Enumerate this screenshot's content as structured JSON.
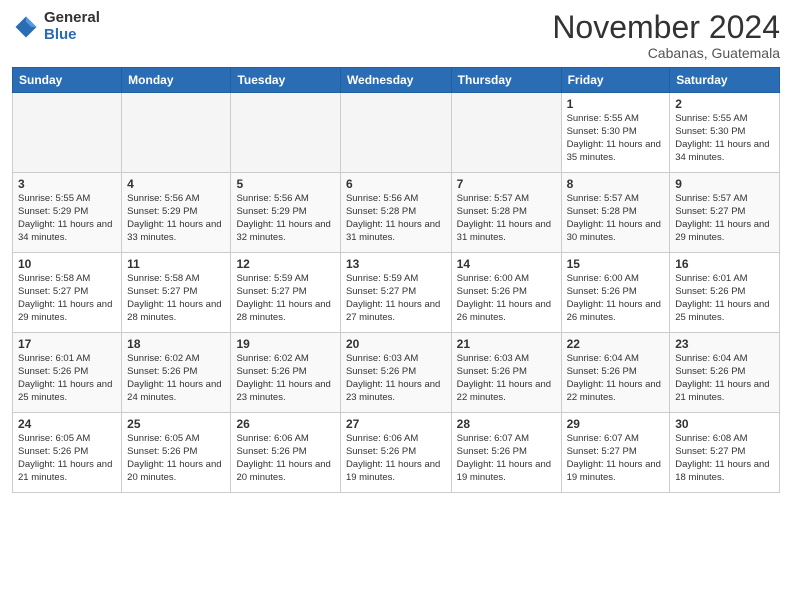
{
  "logo": {
    "general": "General",
    "blue": "Blue"
  },
  "title": "November 2024",
  "location": "Cabanas, Guatemala",
  "days_of_week": [
    "Sunday",
    "Monday",
    "Tuesday",
    "Wednesday",
    "Thursday",
    "Friday",
    "Saturday"
  ],
  "weeks": [
    [
      {
        "day": "",
        "empty": true
      },
      {
        "day": "",
        "empty": true
      },
      {
        "day": "",
        "empty": true
      },
      {
        "day": "",
        "empty": true
      },
      {
        "day": "",
        "empty": true
      },
      {
        "day": "1",
        "sunrise": "Sunrise: 5:55 AM",
        "sunset": "Sunset: 5:30 PM",
        "daylight": "Daylight: 11 hours and 35 minutes."
      },
      {
        "day": "2",
        "sunrise": "Sunrise: 5:55 AM",
        "sunset": "Sunset: 5:30 PM",
        "daylight": "Daylight: 11 hours and 34 minutes."
      }
    ],
    [
      {
        "day": "3",
        "sunrise": "Sunrise: 5:55 AM",
        "sunset": "Sunset: 5:29 PM",
        "daylight": "Daylight: 11 hours and 34 minutes."
      },
      {
        "day": "4",
        "sunrise": "Sunrise: 5:56 AM",
        "sunset": "Sunset: 5:29 PM",
        "daylight": "Daylight: 11 hours and 33 minutes."
      },
      {
        "day": "5",
        "sunrise": "Sunrise: 5:56 AM",
        "sunset": "Sunset: 5:29 PM",
        "daylight": "Daylight: 11 hours and 32 minutes."
      },
      {
        "day": "6",
        "sunrise": "Sunrise: 5:56 AM",
        "sunset": "Sunset: 5:28 PM",
        "daylight": "Daylight: 11 hours and 31 minutes."
      },
      {
        "day": "7",
        "sunrise": "Sunrise: 5:57 AM",
        "sunset": "Sunset: 5:28 PM",
        "daylight": "Daylight: 11 hours and 31 minutes."
      },
      {
        "day": "8",
        "sunrise": "Sunrise: 5:57 AM",
        "sunset": "Sunset: 5:28 PM",
        "daylight": "Daylight: 11 hours and 30 minutes."
      },
      {
        "day": "9",
        "sunrise": "Sunrise: 5:57 AM",
        "sunset": "Sunset: 5:27 PM",
        "daylight": "Daylight: 11 hours and 29 minutes."
      }
    ],
    [
      {
        "day": "10",
        "sunrise": "Sunrise: 5:58 AM",
        "sunset": "Sunset: 5:27 PM",
        "daylight": "Daylight: 11 hours and 29 minutes."
      },
      {
        "day": "11",
        "sunrise": "Sunrise: 5:58 AM",
        "sunset": "Sunset: 5:27 PM",
        "daylight": "Daylight: 11 hours and 28 minutes."
      },
      {
        "day": "12",
        "sunrise": "Sunrise: 5:59 AM",
        "sunset": "Sunset: 5:27 PM",
        "daylight": "Daylight: 11 hours and 28 minutes."
      },
      {
        "day": "13",
        "sunrise": "Sunrise: 5:59 AM",
        "sunset": "Sunset: 5:27 PM",
        "daylight": "Daylight: 11 hours and 27 minutes."
      },
      {
        "day": "14",
        "sunrise": "Sunrise: 6:00 AM",
        "sunset": "Sunset: 5:26 PM",
        "daylight": "Daylight: 11 hours and 26 minutes."
      },
      {
        "day": "15",
        "sunrise": "Sunrise: 6:00 AM",
        "sunset": "Sunset: 5:26 PM",
        "daylight": "Daylight: 11 hours and 26 minutes."
      },
      {
        "day": "16",
        "sunrise": "Sunrise: 6:01 AM",
        "sunset": "Sunset: 5:26 PM",
        "daylight": "Daylight: 11 hours and 25 minutes."
      }
    ],
    [
      {
        "day": "17",
        "sunrise": "Sunrise: 6:01 AM",
        "sunset": "Sunset: 5:26 PM",
        "daylight": "Daylight: 11 hours and 25 minutes."
      },
      {
        "day": "18",
        "sunrise": "Sunrise: 6:02 AM",
        "sunset": "Sunset: 5:26 PM",
        "daylight": "Daylight: 11 hours and 24 minutes."
      },
      {
        "day": "19",
        "sunrise": "Sunrise: 6:02 AM",
        "sunset": "Sunset: 5:26 PM",
        "daylight": "Daylight: 11 hours and 23 minutes."
      },
      {
        "day": "20",
        "sunrise": "Sunrise: 6:03 AM",
        "sunset": "Sunset: 5:26 PM",
        "daylight": "Daylight: 11 hours and 23 minutes."
      },
      {
        "day": "21",
        "sunrise": "Sunrise: 6:03 AM",
        "sunset": "Sunset: 5:26 PM",
        "daylight": "Daylight: 11 hours and 22 minutes."
      },
      {
        "day": "22",
        "sunrise": "Sunrise: 6:04 AM",
        "sunset": "Sunset: 5:26 PM",
        "daylight": "Daylight: 11 hours and 22 minutes."
      },
      {
        "day": "23",
        "sunrise": "Sunrise: 6:04 AM",
        "sunset": "Sunset: 5:26 PM",
        "daylight": "Daylight: 11 hours and 21 minutes."
      }
    ],
    [
      {
        "day": "24",
        "sunrise": "Sunrise: 6:05 AM",
        "sunset": "Sunset: 5:26 PM",
        "daylight": "Daylight: 11 hours and 21 minutes."
      },
      {
        "day": "25",
        "sunrise": "Sunrise: 6:05 AM",
        "sunset": "Sunset: 5:26 PM",
        "daylight": "Daylight: 11 hours and 20 minutes."
      },
      {
        "day": "26",
        "sunrise": "Sunrise: 6:06 AM",
        "sunset": "Sunset: 5:26 PM",
        "daylight": "Daylight: 11 hours and 20 minutes."
      },
      {
        "day": "27",
        "sunrise": "Sunrise: 6:06 AM",
        "sunset": "Sunset: 5:26 PM",
        "daylight": "Daylight: 11 hours and 19 minutes."
      },
      {
        "day": "28",
        "sunrise": "Sunrise: 6:07 AM",
        "sunset": "Sunset: 5:26 PM",
        "daylight": "Daylight: 11 hours and 19 minutes."
      },
      {
        "day": "29",
        "sunrise": "Sunrise: 6:07 AM",
        "sunset": "Sunset: 5:27 PM",
        "daylight": "Daylight: 11 hours and 19 minutes."
      },
      {
        "day": "30",
        "sunrise": "Sunrise: 6:08 AM",
        "sunset": "Sunset: 5:27 PM",
        "daylight": "Daylight: 11 hours and 18 minutes."
      }
    ]
  ]
}
